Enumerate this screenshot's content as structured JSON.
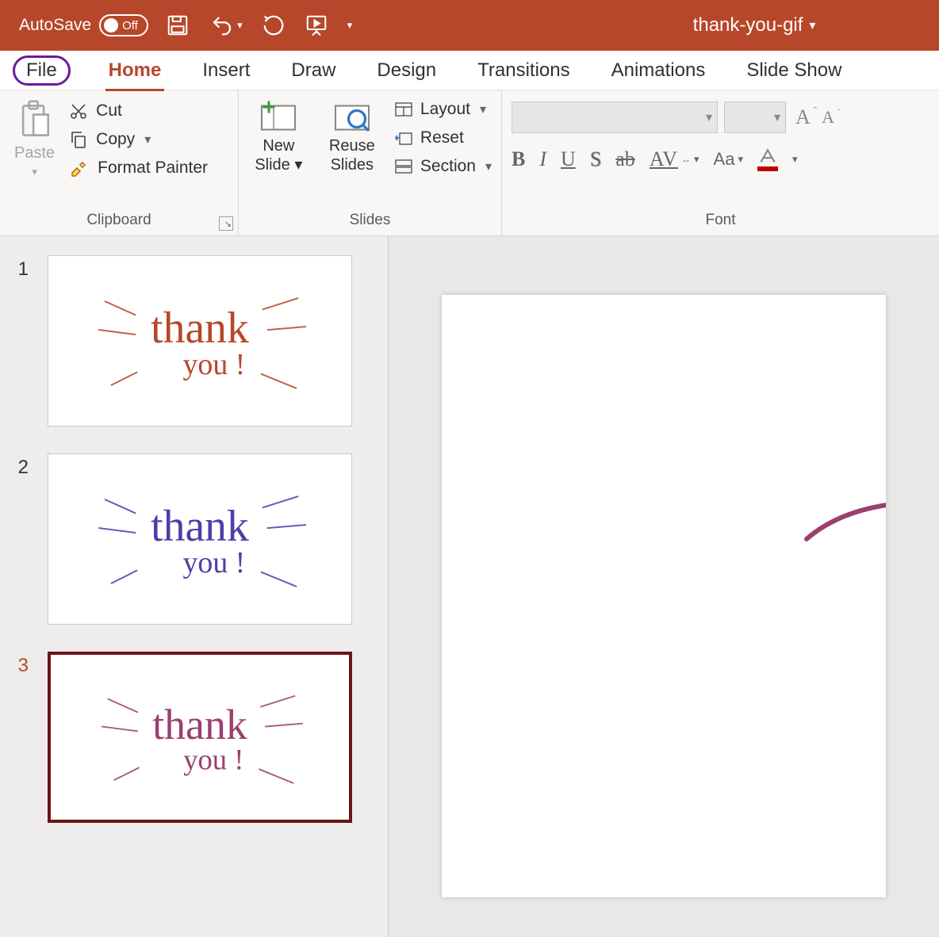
{
  "titlebar": {
    "autosave_label": "AutoSave",
    "autosave_state": "Off",
    "doc_title": "thank-you-gif"
  },
  "tabs": {
    "file": "File",
    "home": "Home",
    "insert": "Insert",
    "draw": "Draw",
    "design": "Design",
    "transitions": "Transitions",
    "animations": "Animations",
    "slideshow": "Slide Show"
  },
  "ribbon": {
    "clipboard": {
      "paste": "Paste",
      "cut": "Cut",
      "copy": "Copy",
      "format_painter": "Format Painter",
      "group_label": "Clipboard"
    },
    "slides": {
      "new_slide": "New Slide",
      "reuse_slides": "Reuse Slides",
      "layout": "Layout",
      "reset": "Reset",
      "section": "Section",
      "group_label": "Slides"
    },
    "font": {
      "bold": "B",
      "italic": "I",
      "underline": "U",
      "shadow": "S",
      "strike": "ab",
      "spacing": "AV",
      "case": "Aa",
      "increase_label": "A",
      "decrease_label": "A",
      "group_label": "Font"
    }
  },
  "thumbnails": {
    "slide1": {
      "num": "1",
      "text_main": "thank",
      "text_sub": "you !",
      "color": "#b7472a"
    },
    "slide2": {
      "num": "2",
      "text_main": "thank",
      "text_sub": "you !",
      "color": "#4b3fa8"
    },
    "slide3": {
      "num": "3",
      "text_main": "thank",
      "text_sub": "you !",
      "color": "#9b3f6f"
    }
  }
}
